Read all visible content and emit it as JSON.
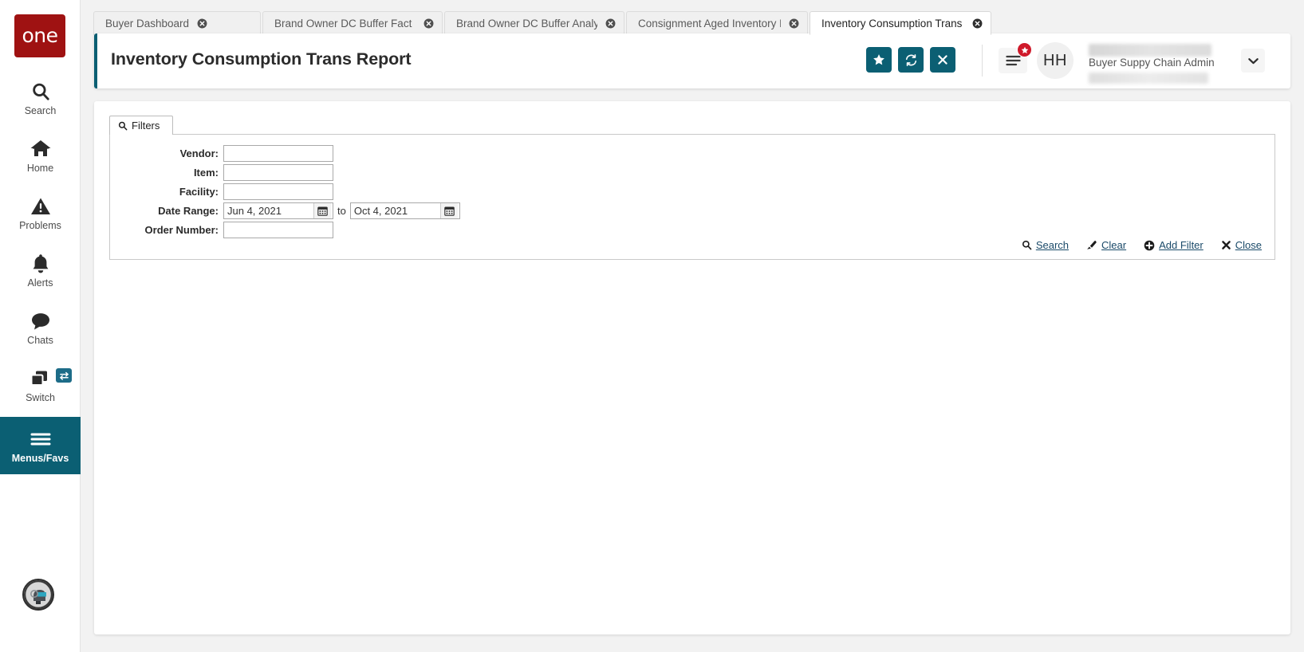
{
  "app": {
    "logo_text": "one",
    "accent_color": "#0b5f73",
    "logo_color": "#9f1212",
    "badge_color": "#cf1a2b",
    "link_color": "#1a4a69"
  },
  "rail": {
    "items": [
      {
        "label": "Search",
        "icon": "search-icon",
        "active": false
      },
      {
        "label": "Home",
        "icon": "home-icon",
        "active": false
      },
      {
        "label": "Problems",
        "icon": "warning-icon",
        "active": false
      },
      {
        "label": "Alerts",
        "icon": "bell-icon",
        "active": false
      },
      {
        "label": "Chats",
        "icon": "chat-icon",
        "active": false
      },
      {
        "label": "Switch",
        "icon": "switch-icon",
        "active": false
      },
      {
        "label": "Menus/Favs",
        "icon": "hamburger-icon",
        "active": true
      }
    ],
    "bot_avatar": "ai-assistant-avatar"
  },
  "tabs": [
    {
      "label": "Buyer Dashboard",
      "active": false
    },
    {
      "label": "Brand Owner DC Buffer Fact Rep...",
      "active": false
    },
    {
      "label": "Brand Owner DC Buffer Analytic...",
      "active": false
    },
    {
      "label": "Consignment Aged Inventory Re...",
      "active": false
    },
    {
      "label": "Inventory Consumption Trans Re...",
      "active": true
    }
  ],
  "header": {
    "title": "Inventory Consumption Trans Report",
    "buttons": [
      {
        "name": "favorite-button",
        "icon": "star-icon"
      },
      {
        "name": "refresh-button",
        "icon": "refresh-icon"
      },
      {
        "name": "close-button",
        "icon": "x-icon"
      }
    ],
    "menu_icon": "hamburger-icon",
    "menu_badge_icon": "star-icon",
    "avatar_initials": "HH",
    "user_role": "Buyer Suppy Chain Admin",
    "caret_icon": "chevron-down-icon"
  },
  "filters": {
    "tab_label": "Filters",
    "tab_icon": "search-icon",
    "fields": [
      {
        "label": "Vendor:",
        "value": "",
        "placeholder": ""
      },
      {
        "label": "Item:",
        "value": "",
        "placeholder": ""
      },
      {
        "label": "Facility:",
        "value": "",
        "placeholder": ""
      },
      {
        "label": "Order Number:",
        "value": "",
        "placeholder": ""
      }
    ],
    "date_range": {
      "label": "Date Range:",
      "from": "Jun 4, 2021",
      "to_word": "to",
      "to": "Oct 4, 2021",
      "calendar_icon": "calendar-icon"
    },
    "actions": [
      {
        "label": "Search",
        "icon": "search-icon"
      },
      {
        "label": "Clear",
        "icon": "eraser-icon"
      },
      {
        "label": "Add Filter",
        "icon": "plus-circle-icon"
      },
      {
        "label": "Close",
        "icon": "x-icon"
      }
    ]
  }
}
